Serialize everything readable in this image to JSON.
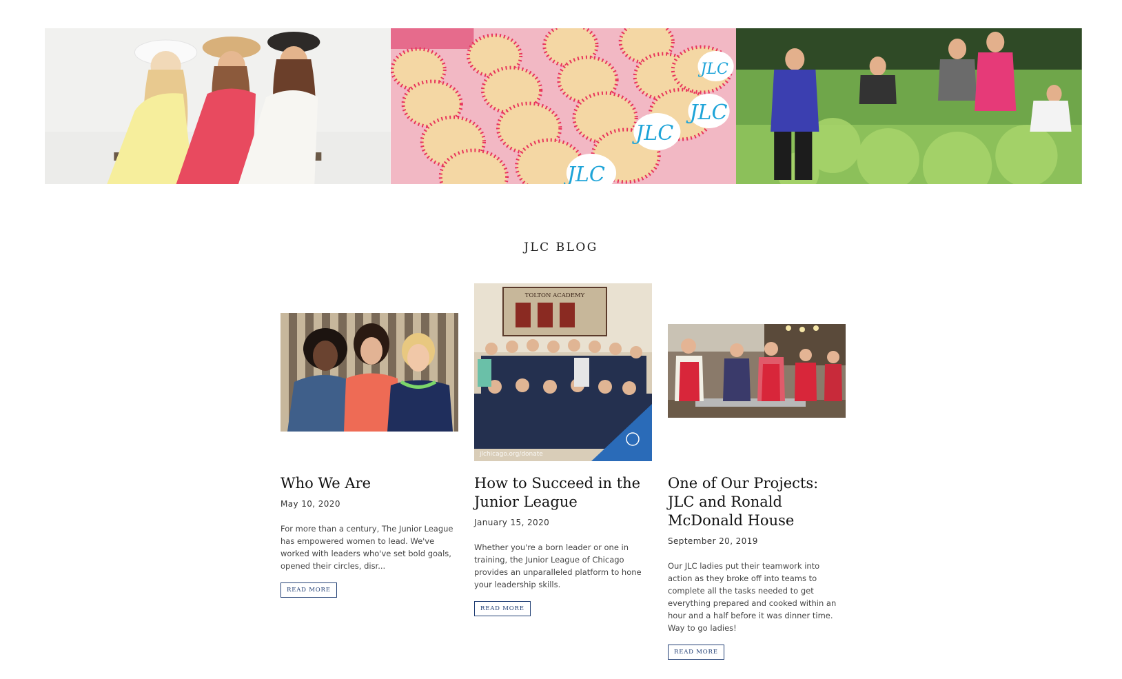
{
  "blog": {
    "heading": "JLC BLOG"
  },
  "colors": {
    "accent": "#1f3d73",
    "jlc_logo_blue": "#1ea4d8",
    "cookie_red": "#e8345a"
  },
  "hero": {
    "panels": [
      {
        "icon": "women-laughing-photo"
      },
      {
        "icon": "jlc-cookies-photo",
        "logo_text": "JLC"
      },
      {
        "icon": "garden-volunteers-photo"
      }
    ]
  },
  "posts": [
    {
      "title": "Who We Are",
      "date": "May 10, 2020",
      "excerpt": "For more than a century, The Junior League has empowered women to lead. We've worked with leaders who've set bold goals, opened their circles, disr...",
      "read_more": "READ MORE",
      "image_icon": "three-women-photo"
    },
    {
      "title": "How to Succeed in the Junior League",
      "date": "January 15, 2020",
      "excerpt": "Whether you're a born leader or one in training, the Junior League of Chicago provides an unparalleled platform to hone your leadership skills.",
      "read_more": "READ MORE",
      "image_icon": "group-photo-tolton-academy",
      "image_sign": "TOLTON ACADEMY",
      "image_caption": "jlchicago.org/donate"
    },
    {
      "title": "One of Our Projects: JLC and Ronald McDonald House",
      "date": "September 20, 2019",
      "excerpt": "Our JLC ladies put their teamwork into action as they broke off into teams to complete all the tasks needed to get everything prepared and cooked within an hour and a half before it was dinner time. Way to go ladies!",
      "read_more": "READ MORE",
      "image_icon": "kitchen-volunteers-photo"
    }
  ]
}
